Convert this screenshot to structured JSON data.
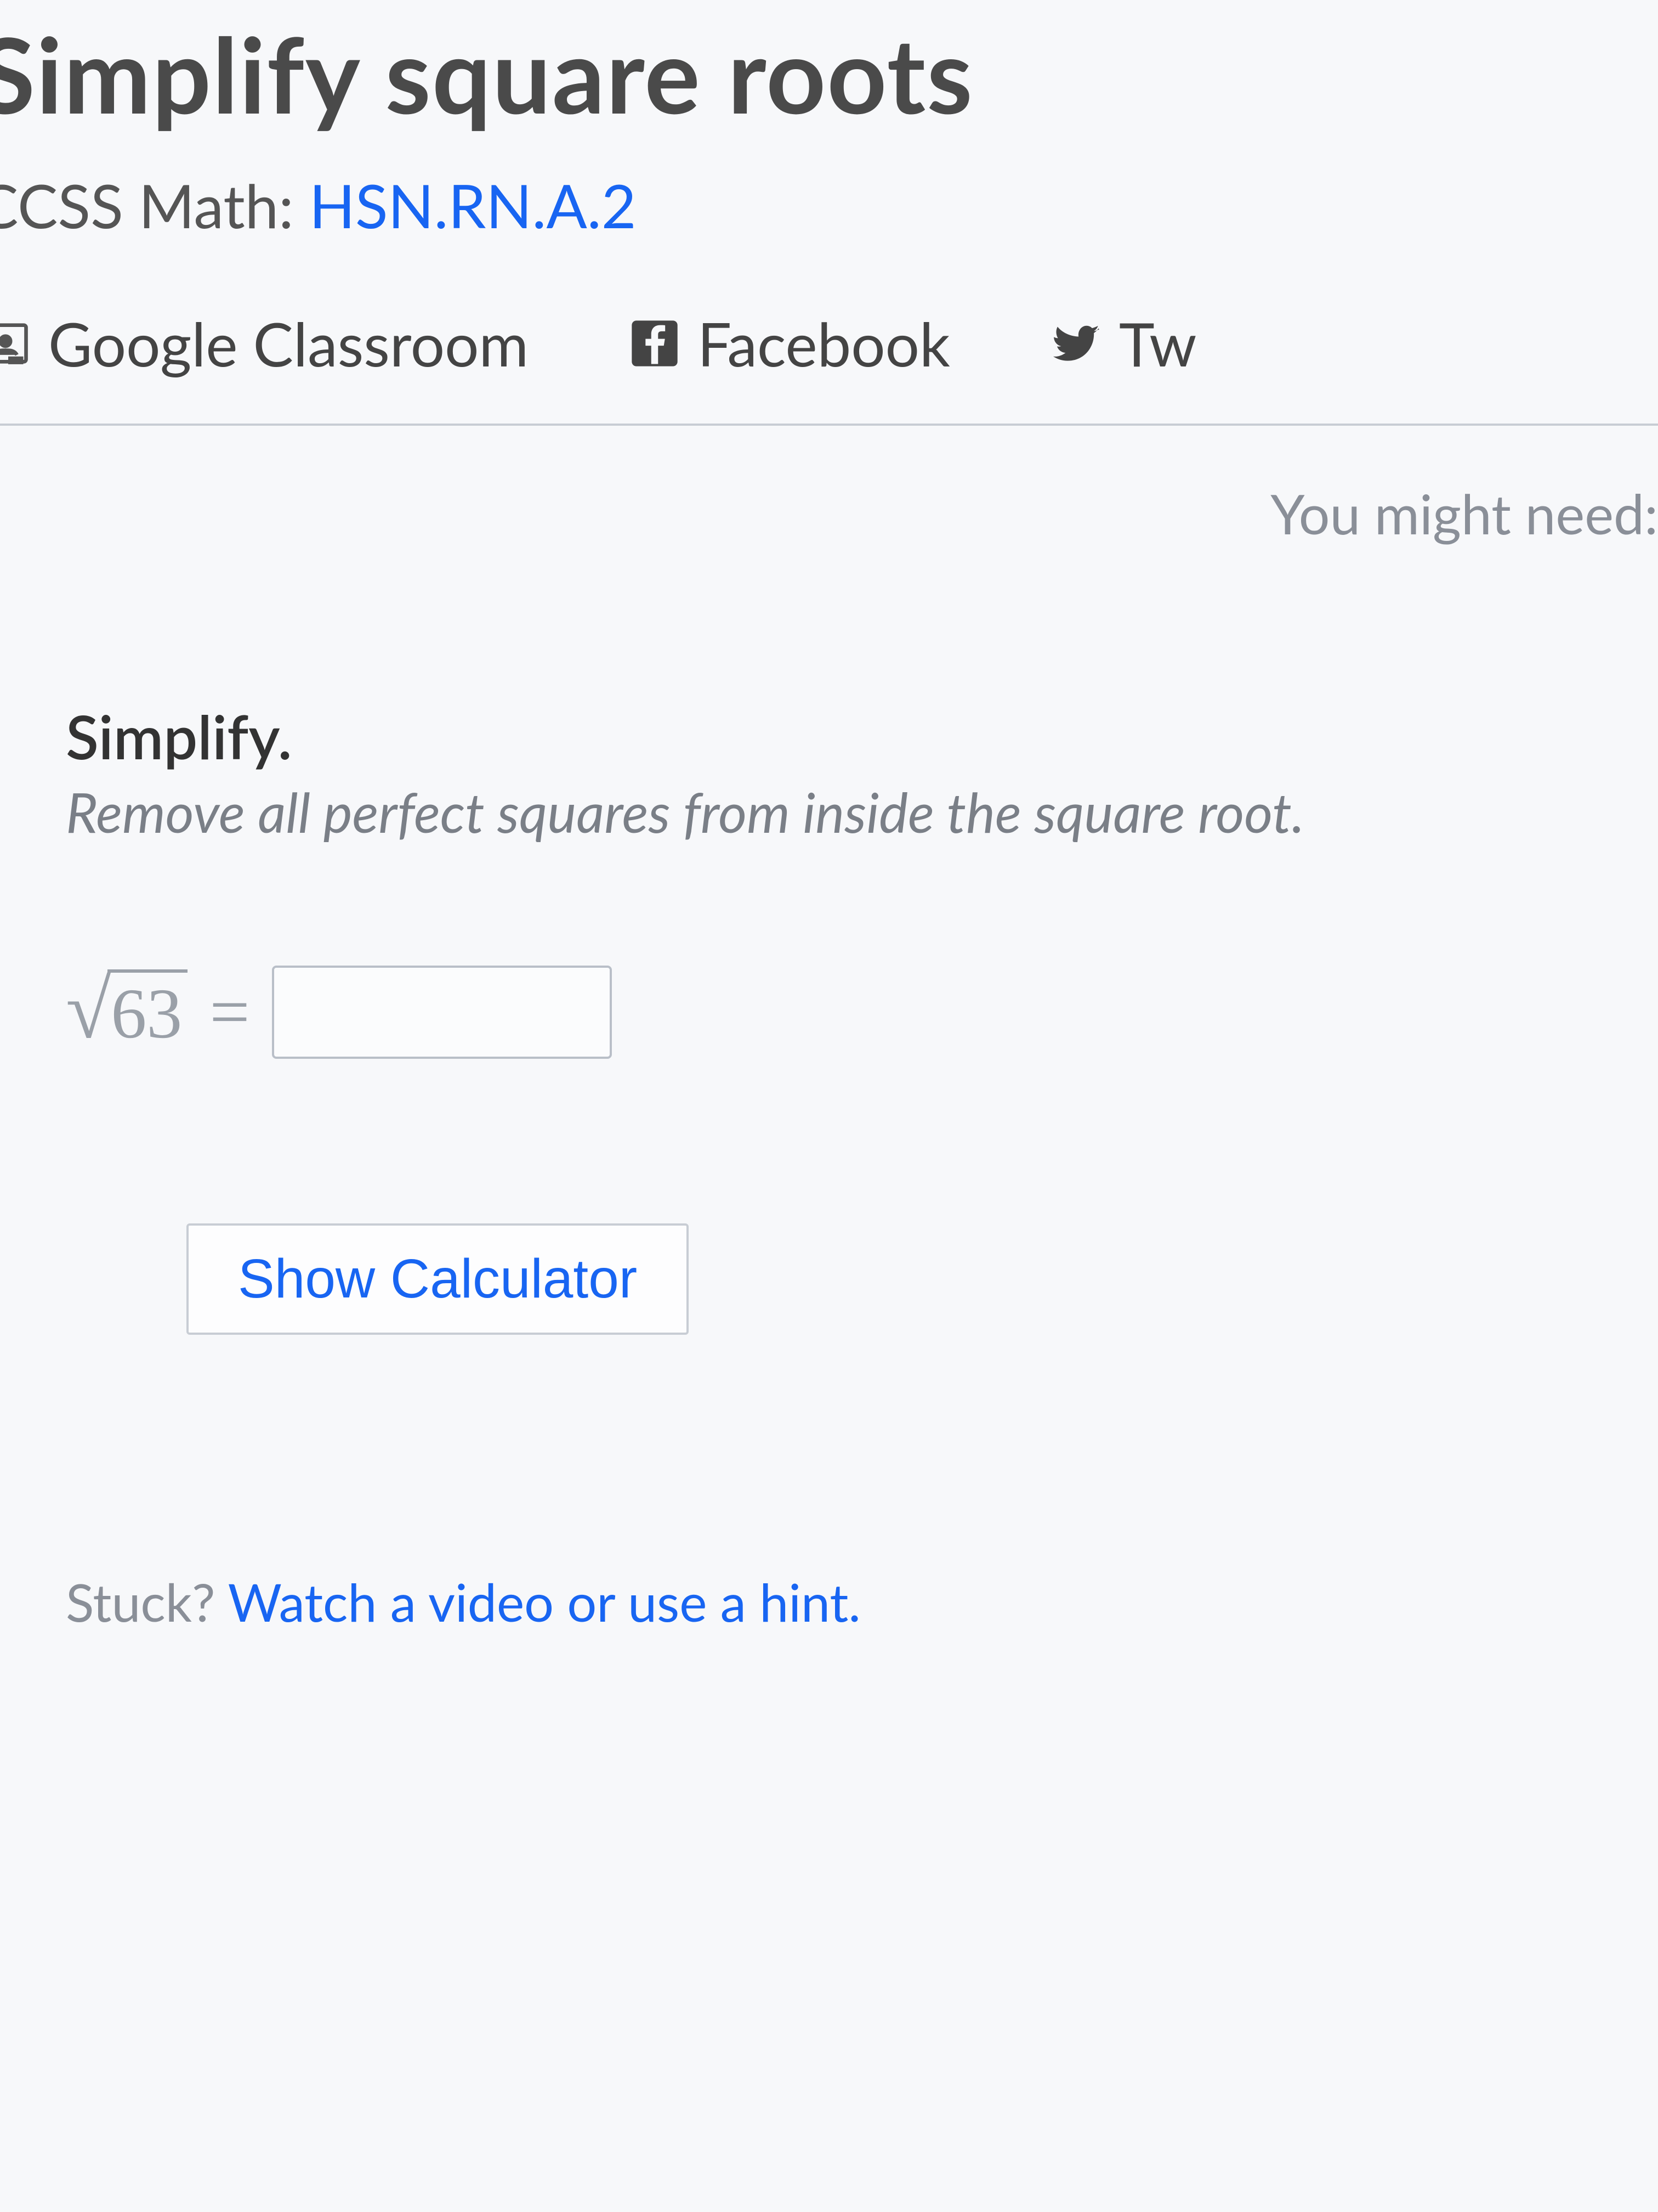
{
  "header": {
    "title": "Simplify square roots",
    "standard_label": "CCSS Math: ",
    "standard_code": "HSN.RN.A.2"
  },
  "share": {
    "google_classroom": "Google Classroom",
    "facebook": "Facebook",
    "twitter": "Tw"
  },
  "hints": {
    "you_might_need": "You might need:"
  },
  "question": {
    "prompt_title": "Simplify.",
    "prompt_instruction": "Remove all perfect squares from inside the square root.",
    "radicand": "63",
    "equals": "=",
    "answer_value": ""
  },
  "buttons": {
    "show_calculator": "Show Calculator"
  },
  "stuck": {
    "prefix": "Stuck? ",
    "link": "Watch a video or use a hint."
  }
}
